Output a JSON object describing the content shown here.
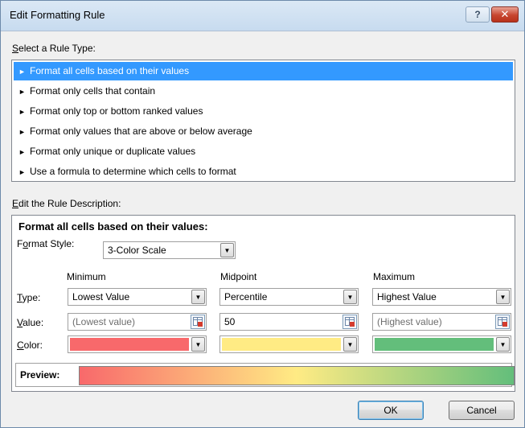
{
  "window": {
    "title": "Edit Formatting Rule",
    "help_glyph": "?",
    "close_glyph": "✕"
  },
  "rule_type_section": {
    "label_key": "S",
    "label_rest": "elect a Rule Type:",
    "items": [
      {
        "label": "Format all cells based on their values",
        "selected": true
      },
      {
        "label": "Format only cells that contain"
      },
      {
        "label": "Format only top or bottom ranked values"
      },
      {
        "label": "Format only values that are above or below average"
      },
      {
        "label": "Format only unique or duplicate values"
      },
      {
        "label": "Use a formula to determine which cells to format"
      }
    ],
    "item_glyph": "►"
  },
  "description_section": {
    "label_key": "E",
    "label_rest": "dit the Rule Description:",
    "heading": "Format all cells based on their values:",
    "format_style": {
      "label_pre": "F",
      "label_key": "o",
      "label_rest": "rmat Style:",
      "value": "3-Color Scale"
    },
    "row_labels": {
      "type": {
        "key": "T",
        "rest": "ype:"
      },
      "value": {
        "key": "V",
        "rest": "alue:"
      },
      "color": {
        "key": "C",
        "rest": "olor:"
      }
    },
    "columns": {
      "minimum": {
        "header": "Minimum",
        "type": "Lowest Value",
        "value": "(Lowest value)",
        "color": "#f8696b"
      },
      "midpoint": {
        "header": "Midpoint",
        "type": "Percentile",
        "value": "50",
        "color": "#ffeb84"
      },
      "maximum": {
        "header": "Maximum",
        "type": "Highest Value",
        "value": "(Highest value)",
        "color": "#63be7b"
      }
    },
    "preview_label": "Preview:"
  },
  "buttons": {
    "ok": "OK",
    "cancel": "Cancel"
  },
  "icons": {
    "dropdown": "chevron-down-icon",
    "cell_reference": "collapse-dialog-icon"
  }
}
